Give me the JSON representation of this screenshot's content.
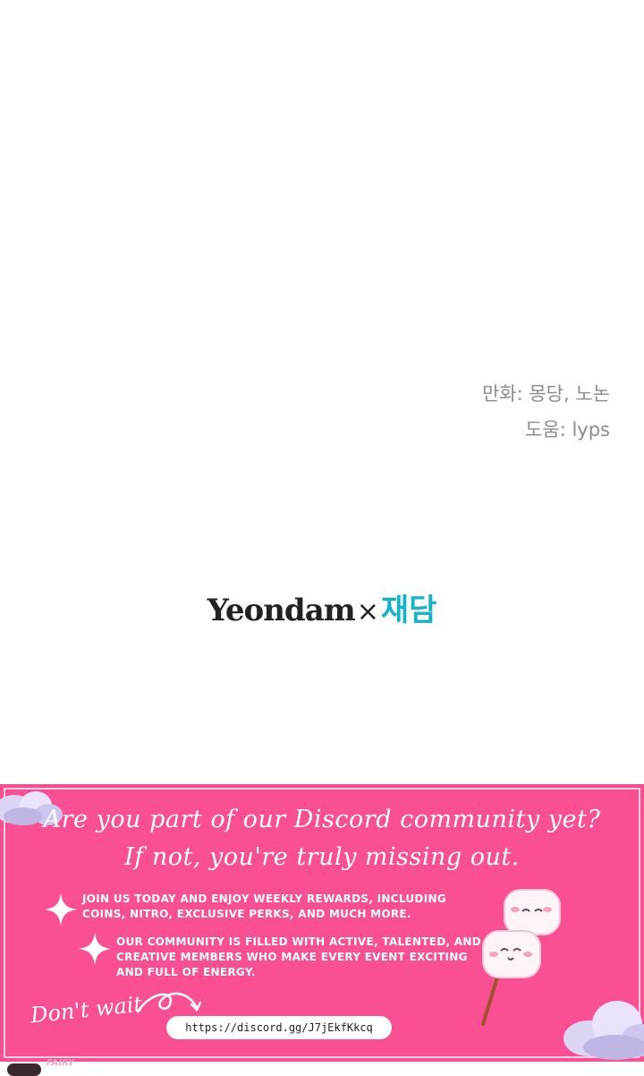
{
  "credits": {
    "line1": "만화: 몽당, 노논",
    "line2": "도움: lyps"
  },
  "logo": {
    "english": "Yeondam",
    "separator": "×",
    "korean": "재담"
  },
  "banner": {
    "headline_line1": "Are you part of our Discord community yet?",
    "headline_line2": "If not, you're truly missing out.",
    "bullets": [
      "JOIN US TODAY AND ENJOY WEEKLY REWARDS, INCLUDING COINS, NITRO, EXCLUSIVE PERKS, AND MUCH MORE.",
      "OUR COMMUNITY IS FILLED WITH ACTIVE, TALENTED, AND CREATIVE MEMBERS WHO MAKE EVERY EVENT EXCITING AND FULL OF ENERGY."
    ],
    "cta": "Don't wait",
    "link": "https://discord.gg/J7jEkfKkcq",
    "background_color": "#fb4f93"
  },
  "footer": {
    "brand": "FAIRY"
  },
  "icons": [
    "sparkle-icon",
    "sparkle-icon",
    "swirl-arrow-icon",
    "cloud-icon",
    "marshmallow-skewer-icon",
    "cloud-icon"
  ]
}
